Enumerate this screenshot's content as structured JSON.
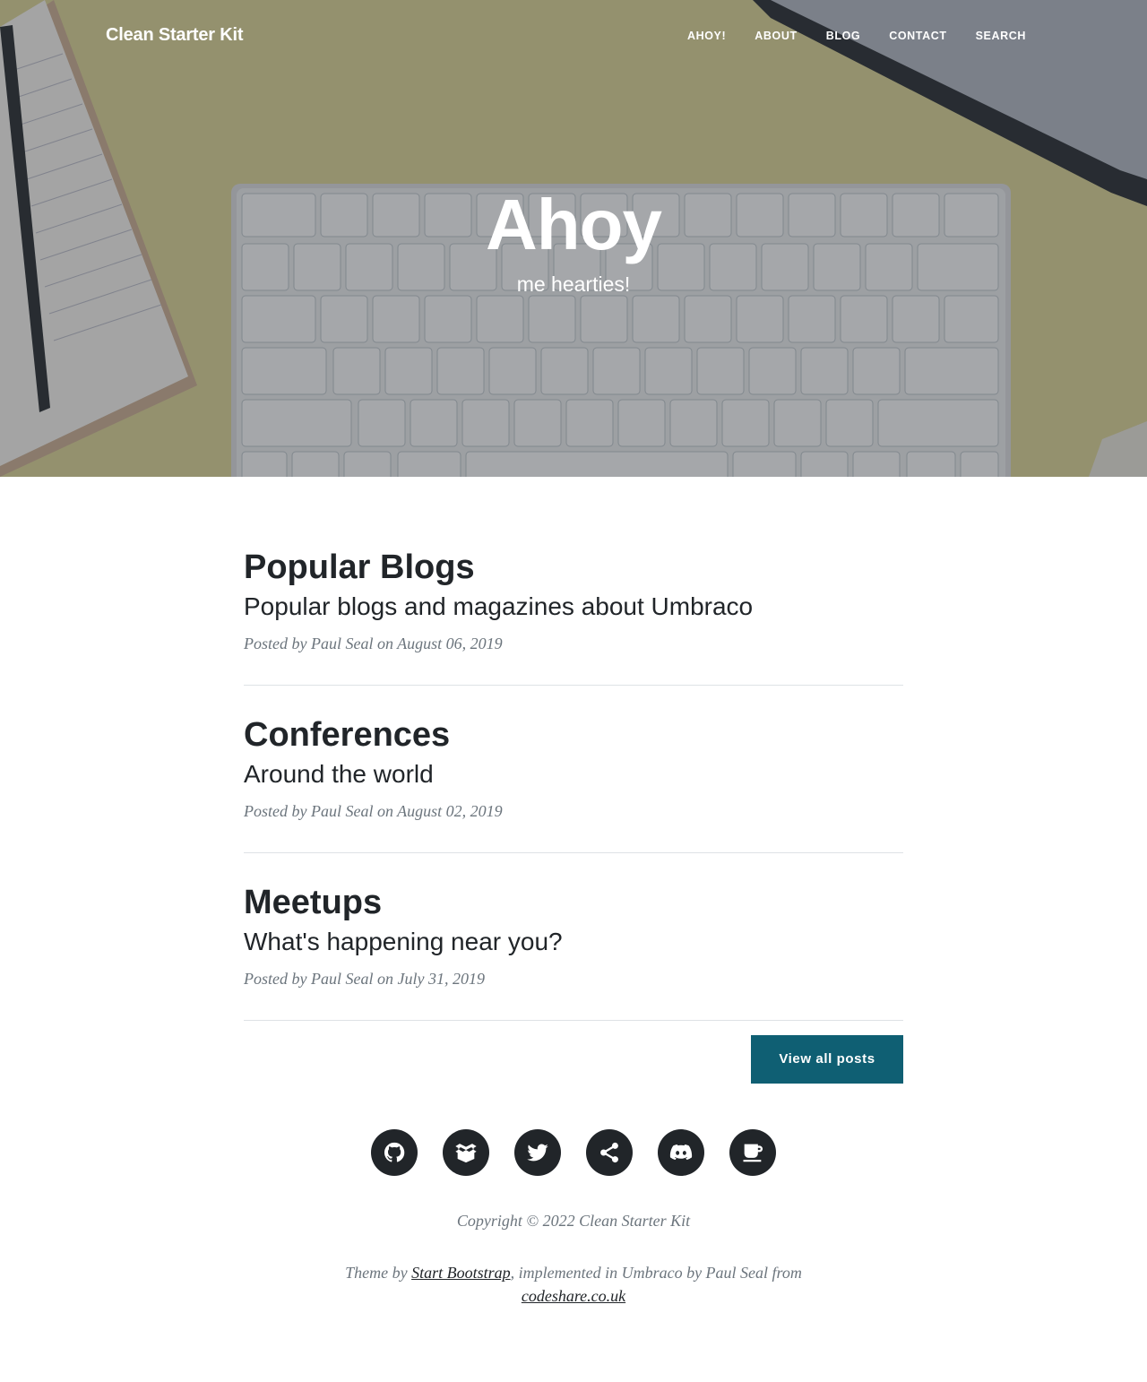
{
  "nav": {
    "brand": "Clean Starter Kit",
    "links": [
      {
        "label": "AHOY!"
      },
      {
        "label": "ABOUT"
      },
      {
        "label": "BLOG"
      },
      {
        "label": "CONTACT"
      },
      {
        "label": "SEARCH"
      }
    ]
  },
  "hero": {
    "title": "Ahoy",
    "subtitle": "me hearties!"
  },
  "posts": [
    {
      "title": "Popular Blogs",
      "subtitle": "Popular blogs and magazines about Umbraco",
      "meta": "Posted by Paul Seal on August 06, 2019"
    },
    {
      "title": "Conferences",
      "subtitle": "Around the world",
      "meta": "Posted by Paul Seal on August 02, 2019"
    },
    {
      "title": "Meetups",
      "subtitle": "What's happening near you?",
      "meta": "Posted by Paul Seal on July 31, 2019"
    }
  ],
  "pager": {
    "view_all_label": "View all posts"
  },
  "footer": {
    "socials": [
      "github-icon",
      "package-icon",
      "twitter-icon",
      "share-icon",
      "discord-icon",
      "coffee-icon"
    ],
    "copyright": "Copyright © 2022 Clean Starter Kit",
    "credits_prefix": "Theme by ",
    "credits_link1": "Start Bootstrap",
    "credits_middle": ", implemented in Umbraco by Paul Seal from ",
    "credits_link2": "codeshare.co.uk"
  },
  "colors": {
    "accent_button": "#0f5f73",
    "text_dark": "#212529",
    "text_muted": "#6c757d"
  }
}
